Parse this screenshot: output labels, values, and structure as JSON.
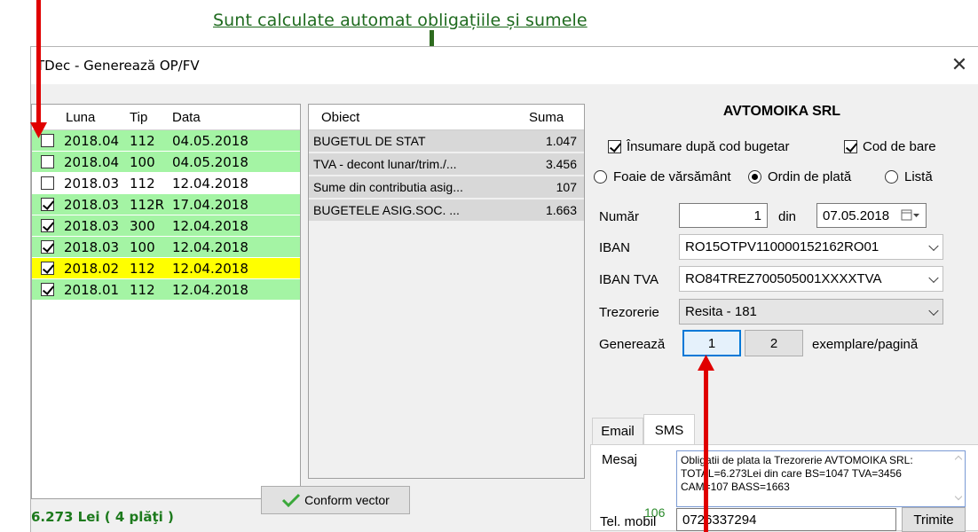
{
  "annotation": {
    "text": "Sunt calculate automat obligațiile și sumele"
  },
  "window": {
    "title": "TDec - Generează OP/FV",
    "close_glyph": "✕"
  },
  "left_grid": {
    "headers": {
      "luna": "Luna",
      "tip": "Tip",
      "data": "Data"
    },
    "rows": [
      {
        "checked": false,
        "luna": "2018.04",
        "tip": "112",
        "data": "04.05.2018",
        "color": "green"
      },
      {
        "checked": false,
        "luna": "2018.04",
        "tip": "100",
        "data": "04.05.2018",
        "color": "green"
      },
      {
        "checked": false,
        "luna": "2018.03",
        "tip": "112",
        "data": "12.04.2018",
        "color": "white"
      },
      {
        "checked": true,
        "luna": "2018.03",
        "tip": "112R",
        "data": "17.04.2018",
        "color": "green"
      },
      {
        "checked": true,
        "luna": "2018.03",
        "tip": "300",
        "data": "12.04.2018",
        "color": "green"
      },
      {
        "checked": true,
        "luna": "2018.03",
        "tip": "100",
        "data": "12.04.2018",
        "color": "green"
      },
      {
        "checked": true,
        "luna": "2018.02",
        "tip": "112",
        "data": "12.04.2018",
        "color": "yellow"
      },
      {
        "checked": true,
        "luna": "2018.01",
        "tip": "112",
        "data": "12.04.2018",
        "color": "green"
      }
    ],
    "total": "6.273 Lei ( 4 plăţi )"
  },
  "middle_grid": {
    "headers": {
      "obiect": "Obiect",
      "suma": "Suma"
    },
    "rows": [
      {
        "obiect": "BUGETUL DE STAT",
        "suma": "1.047"
      },
      {
        "obiect": "TVA - decont lunar/trim./...",
        "suma": "3.456"
      },
      {
        "obiect": "Sume din contributia asig...",
        "suma": "107"
      },
      {
        "obiect": "BUGETELE ASIG.SOC. ...",
        "suma": "1.663"
      }
    ],
    "button_label": "Conform vector"
  },
  "right_panel": {
    "company": "AVTOMOIKA SRL",
    "insumare_label": "Însumare după cod bugetar",
    "cod_bare_label": "Cod de bare",
    "radio": {
      "foaie": "Foaie de vărsământ",
      "ordin": "Ordin de plată",
      "lista": "Listă",
      "selected": "ordin"
    },
    "numar_label": "Număr",
    "numar_value": "1",
    "din_label": "din",
    "date_value": "07.05.2018",
    "iban_label": "IBAN",
    "iban_value": "RO15OTPV110000152162RO01",
    "iban_tva_label": "IBAN TVA",
    "iban_tva_value": "RO84TREZ700505001XXXXTVA",
    "trezorerie_label": "Trezorerie",
    "trezorerie_value": "Resita - 181",
    "genereaza_label": "Generează",
    "gen_options": [
      "1",
      "2"
    ],
    "exemplare_label": "exemplare/pagină"
  },
  "tabs": {
    "email": "Email",
    "sms": "SMS",
    "active": "sms",
    "mesaj_label": "Mesaj",
    "char_count": "106",
    "sms_text": "Obligatii de plata la Trezorerie AVTOMOIKA SRL: TOTAL=6.273Lei din care BS=1047 TVA=3456 CAM=107 BASS=1663",
    "tel_label": "Tel. mobil",
    "tel_value": "0726337294",
    "trimite": "Trimite"
  },
  "colors": {
    "green_row": "#a4f4a4",
    "yellow_row": "#ffff00",
    "annotation_green": "#1f6b1f",
    "arrow_red": "#e00000"
  }
}
